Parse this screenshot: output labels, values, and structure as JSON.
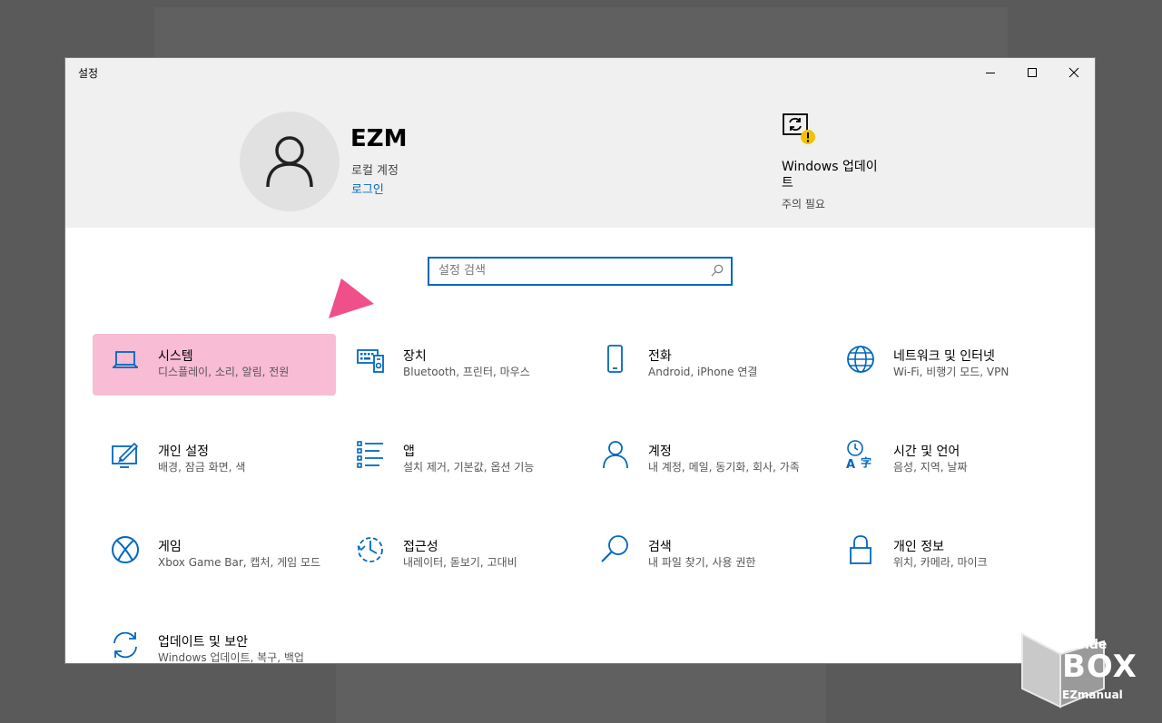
{
  "window": {
    "title": "설정"
  },
  "account": {
    "name": "EZM",
    "type": "로컬 계정",
    "login_link": "로그인"
  },
  "windows_update": {
    "title": "Windows 업데이트",
    "status": "주의 필요"
  },
  "search": {
    "placeholder": "설정 검색"
  },
  "categories": [
    {
      "name": "시스템",
      "desc": "디스플레이, 소리, 알림, 전원",
      "icon": "laptop-icon"
    },
    {
      "name": "장치",
      "desc": "Bluetooth, 프린터, 마우스",
      "icon": "devices-icon"
    },
    {
      "name": "전화",
      "desc": "Android, iPhone 연결",
      "icon": "phone-icon"
    },
    {
      "name": "네트워크 및 인터넷",
      "desc": "Wi-Fi, 비행기 모드, VPN",
      "icon": "globe-icon"
    },
    {
      "name": "개인 설정",
      "desc": "배경, 잠금 화면, 색",
      "icon": "personalization-icon"
    },
    {
      "name": "앱",
      "desc": "설치 제거, 기본값, 옵션 기능",
      "icon": "apps-list-icon"
    },
    {
      "name": "계정",
      "desc": "내 계정, 메일, 동기화, 회사, 가족",
      "icon": "person-icon"
    },
    {
      "name": "시간 및 언어",
      "desc": "음성, 지역, 날짜",
      "icon": "time-language-icon"
    },
    {
      "name": "게임",
      "desc": "Xbox Game Bar, 캡처, 게임 모드",
      "icon": "xbox-icon"
    },
    {
      "name": "접근성",
      "desc": "내레이터, 돋보기, 고대비",
      "icon": "ease-of-access-icon"
    },
    {
      "name": "검색",
      "desc": "내 파일 찾기, 사용 권한",
      "icon": "search-icon"
    },
    {
      "name": "개인 정보",
      "desc": "위치, 카메라, 마이크",
      "icon": "lock-icon"
    },
    {
      "name": "업데이트 및 보안",
      "desc": "Windows 업데이트, 복구, 백업",
      "icon": "sync-icon"
    }
  ],
  "watermark_logo": {
    "line1": "inside",
    "line2": "BOX",
    "line3": "EZmanual"
  },
  "colors": {
    "accent": "#0067c0",
    "highlight": "#f8bcd4",
    "arrow": "#f0508a",
    "warning": "#f2c200"
  }
}
